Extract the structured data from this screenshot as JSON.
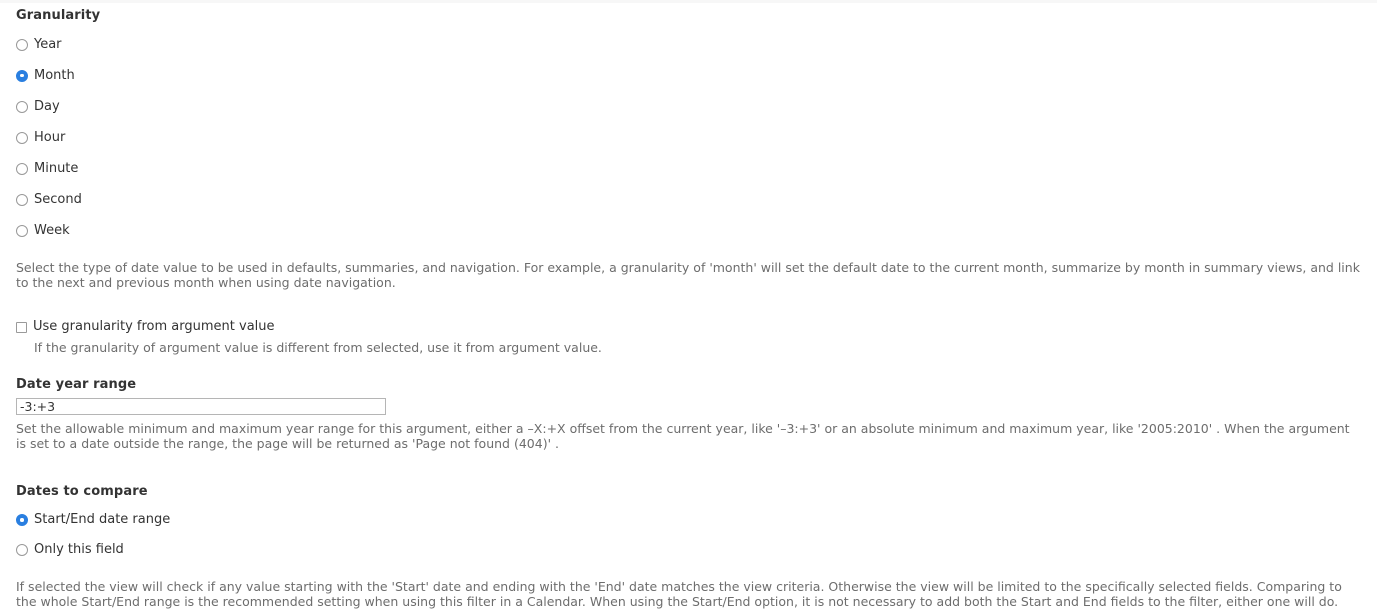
{
  "granularity": {
    "label": "Granularity",
    "options": [
      {
        "label": "Year",
        "selected": false
      },
      {
        "label": "Month",
        "selected": true
      },
      {
        "label": "Day",
        "selected": false
      },
      {
        "label": "Hour",
        "selected": false
      },
      {
        "label": "Minute",
        "selected": false
      },
      {
        "label": "Second",
        "selected": false
      },
      {
        "label": "Week",
        "selected": false
      }
    ],
    "description": "Select the type of date value to be used in defaults, summaries, and navigation. For example, a granularity of 'month' will set the default date to the current month, summarize by month in summary views, and link to the next and previous month when using date navigation."
  },
  "use_granularity_from_argument": {
    "label": "Use granularity from argument value",
    "checked": false,
    "description": "If the granularity of argument value is different from selected, use it from argument value."
  },
  "date_year_range": {
    "label": "Date year range",
    "value": "-3:+3",
    "description": "Set the allowable minimum and maximum year range for this argument, either a –X:+X offset from the current year, like '–3:+3' or an absolute minimum and maximum year, like '2005:2010' . When the argument is set to a date outside the range, the page will be returned as 'Page not found (404)' ."
  },
  "dates_to_compare": {
    "label": "Dates to compare",
    "options": [
      {
        "label": "Start/End date range",
        "selected": true
      },
      {
        "label": "Only this field",
        "selected": false
      }
    ],
    "description": "If selected the view will check if any value starting with the 'Start' date and ending with the 'End' date matches the view criteria. Otherwise the view will be limited to the specifically selected fields. Comparing to the whole Start/End range is the recommended setting when using this filter in a Calendar. When using the Start/End option, it is not necessary to add both the Start and End fields to the filter, either one will do."
  },
  "colors": {
    "accent": "#2a7fe0",
    "label_text": "#333333",
    "description_text": "#6d6d6d",
    "input_border": "#b5b5b5",
    "background": "#ffffff"
  }
}
